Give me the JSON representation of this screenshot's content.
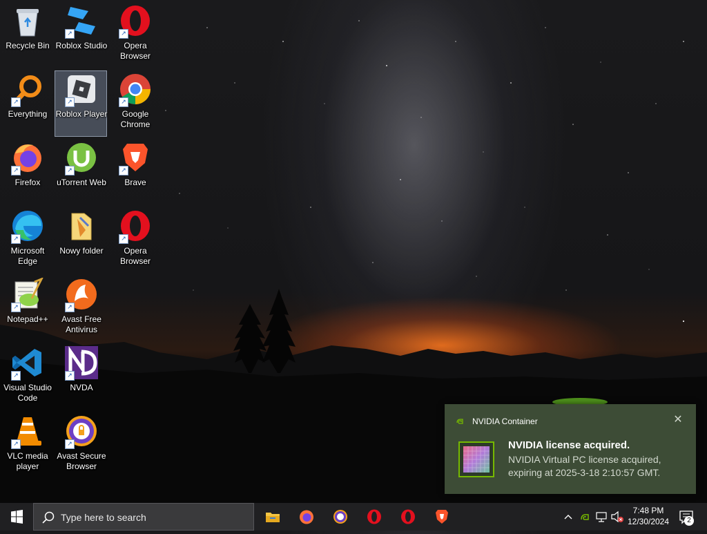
{
  "desktop": {
    "icons": [
      {
        "label": "Recycle Bin",
        "icon": "recycle-bin-icon"
      },
      {
        "label": "Roblox Studio",
        "icon": "roblox-studio-icon"
      },
      {
        "label": "Opera Browser",
        "icon": "opera-icon"
      },
      {
        "label": "Everything",
        "icon": "everything-search-icon"
      },
      {
        "label": "Roblox Player",
        "icon": "roblox-player-icon"
      },
      {
        "label": "Google Chrome",
        "icon": "chrome-icon"
      },
      {
        "label": "Firefox",
        "icon": "firefox-icon"
      },
      {
        "label": "uTorrent Web",
        "icon": "utorrent-icon"
      },
      {
        "label": "Brave",
        "icon": "brave-icon"
      },
      {
        "label": "Microsoft Edge",
        "icon": "edge-icon"
      },
      {
        "label": "Nowy folder",
        "icon": "folder-icon"
      },
      {
        "label": "Opera Browser",
        "icon": "opera-icon"
      },
      {
        "label": "Notepad++",
        "icon": "notepad-plus-plus-icon"
      },
      {
        "label": "Avast Free Antivirus",
        "icon": "avast-icon"
      },
      {
        "label": "Visual Studio Code",
        "icon": "vscode-icon"
      },
      {
        "label": "NVDA",
        "icon": "nvda-icon"
      },
      {
        "label": "VLC media player",
        "icon": "vlc-icon"
      },
      {
        "label": "Avast Secure Browser",
        "icon": "avast-secure-browser-icon"
      }
    ],
    "selected_icon": "Roblox Player"
  },
  "notification": {
    "app_name": "NVIDIA Container",
    "close_glyph": "✕",
    "title": "NVIDIA license acquired.",
    "body": "NVIDIA Virtual PC license acquired, expiring at 2025-3-18 2:10:57 GMT.",
    "accent_color": "#76b900",
    "background_color": "#3d4c36"
  },
  "taskbar": {
    "search_placeholder": "Type here to search",
    "pinned": [
      {
        "name": "file-explorer-icon"
      },
      {
        "name": "firefox-icon"
      },
      {
        "name": "avast-secure-browser-icon"
      },
      {
        "name": "opera-icon"
      },
      {
        "name": "opera-icon"
      },
      {
        "name": "brave-icon"
      }
    ],
    "tray": {
      "time": "7:48 PM",
      "date": "12/30/2024",
      "notification_count": "2"
    }
  }
}
